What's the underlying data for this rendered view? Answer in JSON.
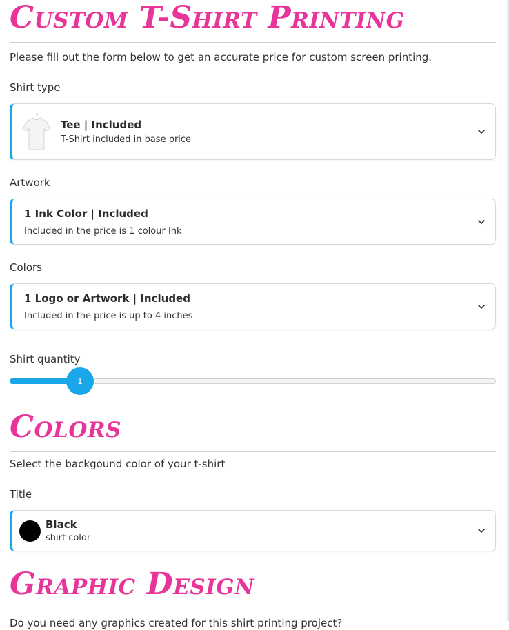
{
  "sections": {
    "printing": {
      "title": "Custom T-Shirt Printing",
      "intro": "Please fill out the form below to get an accurate price for custom screen printing."
    },
    "colors": {
      "title": "Colors",
      "intro": "Select the backgound color of your t-shirt"
    },
    "graphic": {
      "title": "Graphic Design",
      "intro": "Do you need any graphics created for this shirt printing project?"
    }
  },
  "fields": {
    "shirt_type": {
      "label": "Shirt type",
      "selected_title": "Tee | Included",
      "selected_desc": "T-Shirt included in base price",
      "image": "white-tshirt-on-hanger"
    },
    "artwork": {
      "label": "Artwork",
      "selected_title": "1 Ink Color | Included",
      "selected_desc": "Included in the price is 1 colour Ink"
    },
    "colors": {
      "label": "Colors",
      "selected_title": "1 Logo or Artwork | Included",
      "selected_desc": "Included in the price is up to 4 inches"
    },
    "quantity": {
      "label": "Shirt quantity",
      "value": "1",
      "fill_fraction": 0.145
    },
    "background_color": {
      "label": "Title",
      "selected_title": "Black",
      "selected_desc": "shirt color",
      "swatch": "#000000"
    }
  },
  "theme": {
    "accent": "#1aa7ea",
    "heading": "#e8359a"
  },
  "icons": {
    "dropdown": "chevron-down-icon"
  }
}
